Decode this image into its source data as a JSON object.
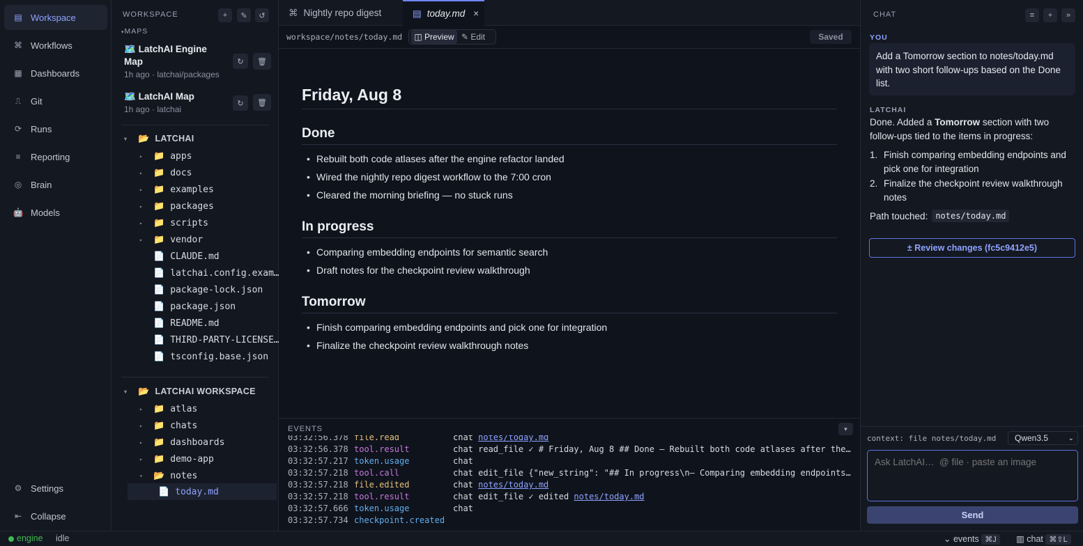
{
  "nav": {
    "items": [
      {
        "label": "Workspace",
        "icon": "▤"
      },
      {
        "label": "Workflows",
        "icon": "⌘"
      },
      {
        "label": "Dashboards",
        "icon": "▦"
      },
      {
        "label": "Git",
        "icon": "⎍"
      },
      {
        "label": "Runs",
        "icon": "⟳"
      },
      {
        "label": "Reporting",
        "icon": "≡"
      },
      {
        "label": "Brain",
        "icon": "◎"
      },
      {
        "label": "Models",
        "icon": "🤖"
      }
    ],
    "settings": "Settings",
    "collapse": "Collapse"
  },
  "explorer": {
    "title": "WORKSPACE",
    "maps_label": "MAPS",
    "maps": [
      {
        "icon": "🗺️",
        "title": "LatchAI Engine Map",
        "meta": "1h ago · latchai/packages"
      },
      {
        "icon": "🗺️",
        "title": "LatchAI Map",
        "meta": "1h ago · latchai"
      }
    ],
    "tree1": {
      "root": "LATCHAI",
      "folders": [
        "apps",
        "docs",
        "examples",
        "packages",
        "scripts",
        "vendor"
      ],
      "files": [
        "CLAUDE.md",
        "latchai.config.exam…",
        "package-lock.json",
        "package.json",
        "README.md",
        "THIRD-PARTY-LICENSE…",
        "tsconfig.base.json"
      ]
    },
    "tree2": {
      "root": "LATCHAI WORKSPACE",
      "folders": [
        "atlas",
        "chats",
        "dashboards",
        "demo-app",
        "notes"
      ],
      "active_file": "today.md"
    }
  },
  "tabs": [
    {
      "icon": "⌘",
      "label": "Nightly repo digest"
    },
    {
      "icon": "▤",
      "label": "today.md",
      "close": "×"
    }
  ],
  "pathbar": {
    "path": "workspace/notes/today.md",
    "preview": "◫ Preview",
    "edit": "✎ Edit",
    "status": "Saved"
  },
  "doc": {
    "title": "Friday, Aug 8",
    "sections": [
      {
        "heading": "Done",
        "items": [
          "Rebuilt both code atlases after the engine refactor landed",
          "Wired the nightly repo digest workflow to the 7:00 cron",
          "Cleared the morning briefing — no stuck runs"
        ]
      },
      {
        "heading": "In progress",
        "items": [
          "Comparing embedding endpoints for semantic search",
          "Draft notes for the checkpoint review walkthrough"
        ]
      },
      {
        "heading": "Tomorrow",
        "items": [
          "Finish comparing embedding endpoints and pick one for integration",
          "Finalize the checkpoint review walkthrough notes"
        ]
      }
    ]
  },
  "events": {
    "title": "EVENTS",
    "rows": [
      {
        "time": "03:32:56.378",
        "kind": "file.read",
        "color": "#e5c07b",
        "prefix": "chat ",
        "link": "notes/today.md",
        "text": ""
      },
      {
        "time": "03:32:56.378",
        "kind": "tool.result",
        "color": "#c678dd",
        "prefix": "chat read_file ✓ # Friday, Aug 8 ## Done – Rebuilt both code atlases after the engine refactor landed",
        "link": "",
        "text": ""
      },
      {
        "time": "03:32:57.217",
        "kind": "token.usage",
        "color": "#61afef",
        "prefix": "chat",
        "link": "",
        "text": ""
      },
      {
        "time": "03:32:57.218",
        "kind": "tool.call",
        "color": "#c678dd",
        "prefix": "chat edit_file {\"new_string\": \"## In progress\\n– Comparing embedding endpoints for semantic search",
        "link": "",
        "text": ""
      },
      {
        "time": "03:32:57.218",
        "kind": "file.edited",
        "color": "#e5c07b",
        "prefix": "chat ",
        "link": "notes/today.md",
        "text": ""
      },
      {
        "time": "03:32:57.218",
        "kind": "tool.result",
        "color": "#c678dd",
        "prefix": "chat edit_file ✓ edited ",
        "link": "notes/today.md",
        "text": ""
      },
      {
        "time": "03:32:57.666",
        "kind": "token.usage",
        "color": "#61afef",
        "prefix": "chat",
        "link": "",
        "text": ""
      },
      {
        "time": "03:32:57.734",
        "kind": "checkpoint.created",
        "color": "#61afef",
        "prefix": "",
        "link": "",
        "text": ""
      }
    ]
  },
  "chat": {
    "title": "CHAT",
    "you_label": "YOU",
    "user_message": "Add a Tomorrow section to notes/today.md with two short follow-ups based on the Done list.",
    "bot_label": "LATCHAI",
    "bot_intro_a": "Done. Added a ",
    "bot_intro_bold": "Tomorrow",
    "bot_intro_b": " section with two follow-ups tied to the items in progress:",
    "bot_items": [
      "Finish comparing embedding endpoints and pick one for integration",
      "Finalize the checkpoint review walkthrough notes"
    ],
    "path_label": "Path touched:",
    "path_value": "notes/today.md",
    "review_button": "± Review changes (fc5c9412e5)",
    "context": "context: file notes/today.md",
    "model": "Qwen3.5",
    "input_placeholder": "Ask LatchAI…  @ file · paste an image",
    "send": "Send"
  },
  "status": {
    "engine": "engine",
    "state": "idle",
    "events": "⌄ events",
    "events_kbd": "⌘J",
    "chat": "▥ chat",
    "chat_kbd": "⌘⇧L"
  },
  "colors": {
    "accent": "#6f86f5",
    "link": "#8fa3ff",
    "engine_dot": "#3fb950"
  }
}
